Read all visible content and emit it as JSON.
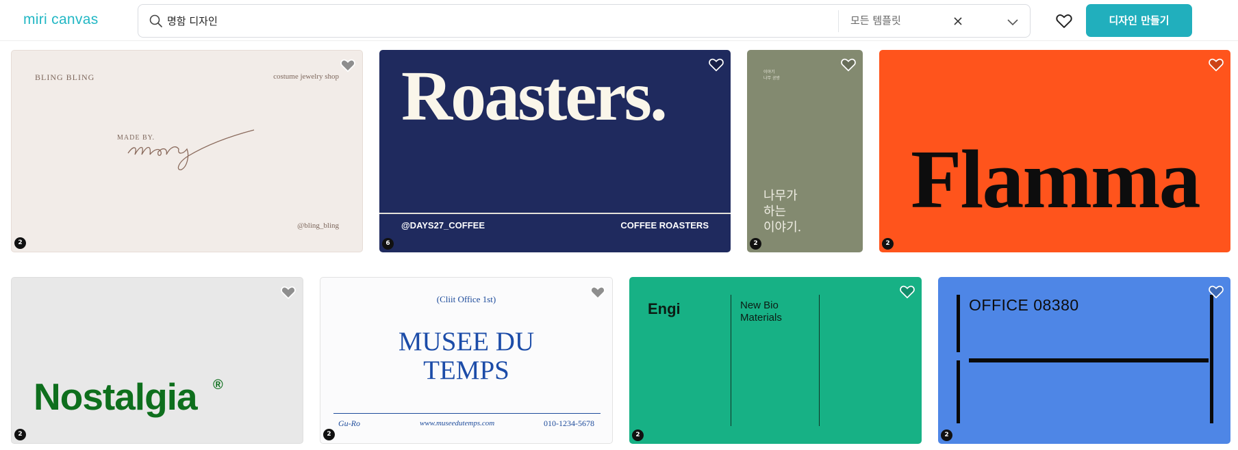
{
  "header": {
    "logo": "miri canvas",
    "search": {
      "query": "명함 디자인",
      "filter_label": "모든 템플릿"
    },
    "create_button": "디자인 만들기"
  },
  "templates": [
    {
      "lines": [
        "BLING BLING",
        "costume jewelry shop",
        "MADE BY.",
        "mery",
        "@bling_bling"
      ],
      "page_count": "2"
    },
    {
      "lines": [
        "Roasters.",
        "@DAYS27_COFFEE",
        "COFFEE ROASTERS"
      ],
      "page_count": "6"
    },
    {
      "lines": [
        "나무가\n하는\n이야기."
      ],
      "page_count": "2"
    },
    {
      "lines": [
        "Flamma"
      ],
      "page_count": "2"
    },
    {
      "lines": [
        "Nostalgia",
        "®"
      ],
      "page_count": "2"
    },
    {
      "lines": [
        "(Cliit Office 1st)",
        "MUSEE DU\nTEMPS",
        "Gu-Ro",
        "www.museedutemps.com",
        "010-1234-5678"
      ],
      "page_count": "2"
    },
    {
      "lines": [
        "Engi",
        "New Bio\nMaterials"
      ],
      "page_count": "2"
    },
    {
      "lines": [
        "OFFICE 08380"
      ],
      "page_count": "2"
    }
  ],
  "colors": {
    "accent": "#21afbd",
    "logo": "#22b7c4"
  }
}
